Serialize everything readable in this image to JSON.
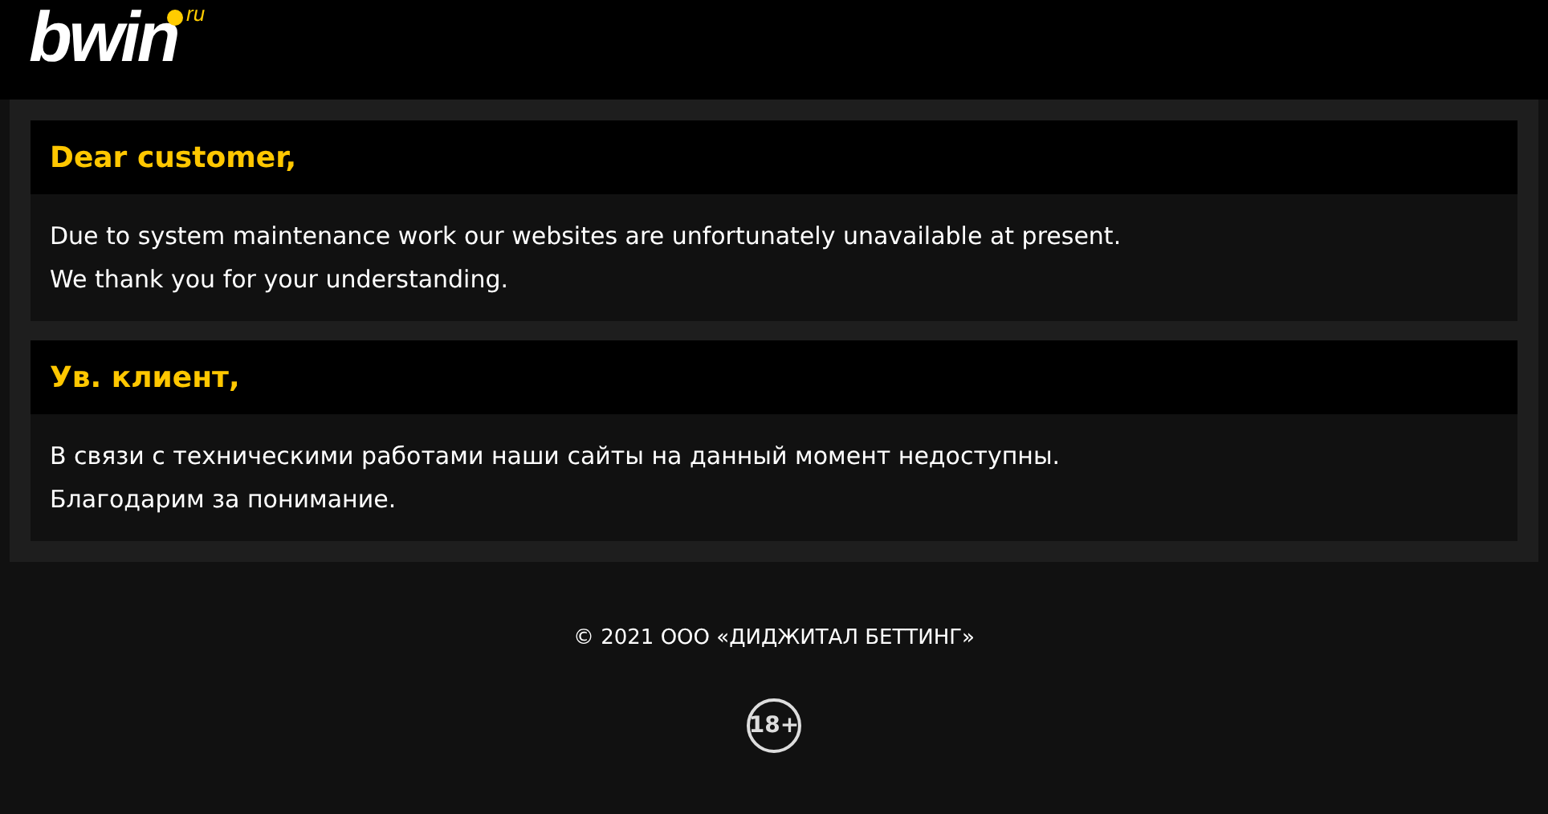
{
  "logo": {
    "name": "bwin",
    "suffix": "ru"
  },
  "notices": [
    {
      "title": "Dear customer,",
      "lines": [
        "Due to system maintenance work our websites are unfortunately unavailable at present.",
        "We thank you for your understanding."
      ]
    },
    {
      "title": "Ув. клиент,",
      "lines": [
        "В связи с техническими работами наши сайты на данный момент недоступны.",
        "Благодарим за понимание."
      ]
    }
  ],
  "footer": {
    "copyright": "© 2021 ООО «ДИДЖИТАЛ БЕТТИНГ»",
    "age_badge": "18+"
  }
}
